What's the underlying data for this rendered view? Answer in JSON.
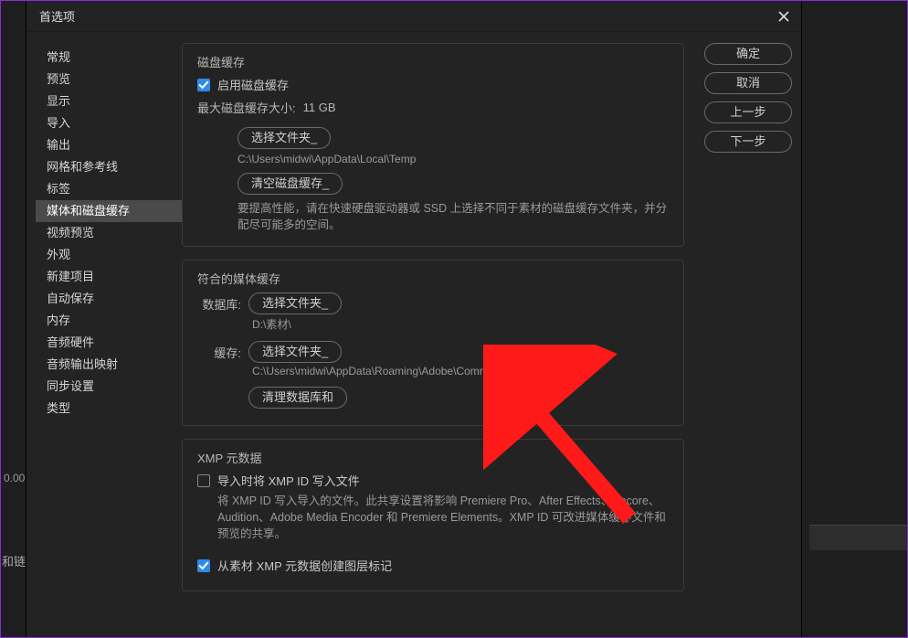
{
  "dialog": {
    "title": "首选项"
  },
  "sidebar": {
    "items": [
      {
        "label": "常规"
      },
      {
        "label": "预览"
      },
      {
        "label": "显示"
      },
      {
        "label": "导入"
      },
      {
        "label": "输出"
      },
      {
        "label": "网格和参考线"
      },
      {
        "label": "标签"
      },
      {
        "label": "媒体和磁盘缓存",
        "selected": true
      },
      {
        "label": "视频预览"
      },
      {
        "label": "外观"
      },
      {
        "label": "新建项目"
      },
      {
        "label": "自动保存"
      },
      {
        "label": "内存"
      },
      {
        "label": "音频硬件"
      },
      {
        "label": "音频输出映射"
      },
      {
        "label": "同步设置"
      },
      {
        "label": "类型"
      }
    ]
  },
  "disk_cache": {
    "heading": "磁盘缓存",
    "enable_label": "启用磁盘缓存",
    "max_label": "最大磁盘缓存大小:",
    "max_value": "11 GB",
    "choose_folder": "选择文件夹_",
    "path": "C:\\Users\\midwi\\AppData\\Local\\Temp",
    "empty_cache": "清空磁盘缓存_",
    "help": "要提高性能，请在快速硬盘驱动器或 SSD 上选择不同于素材的磁盘缓存文件夹，并分配尽可能多的空间。"
  },
  "media_cache": {
    "heading": "符合的媒体缓存",
    "db_label": "数据库:",
    "choose_folder": "选择文件夹_",
    "db_path": "D:\\素材\\",
    "cache_label": "缓存:",
    "cache_path": "C:\\Users\\midwi\\AppData\\Roaming\\Adobe\\Common\\",
    "clean": "清理数据库和"
  },
  "xmp": {
    "heading": "XMP 元数据",
    "write_label": "导入时将 XMP ID 写入文件",
    "write_help": "将 XMP ID 写入导入的文件。此共享设置将影响 Premiere Pro、After Effects、Encore、Audition、Adobe Media Encoder 和 Premiere Elements。XMP ID 可改进媒体缓存文件和预览的共享。",
    "layer_markers": "从素材 XMP 元数据创建图层标记"
  },
  "buttons": {
    "ok": "确定",
    "cancel": "取消",
    "prev": "上一步",
    "next": "下一步"
  },
  "bg": {
    "time": "0.00",
    "label": "和链"
  }
}
